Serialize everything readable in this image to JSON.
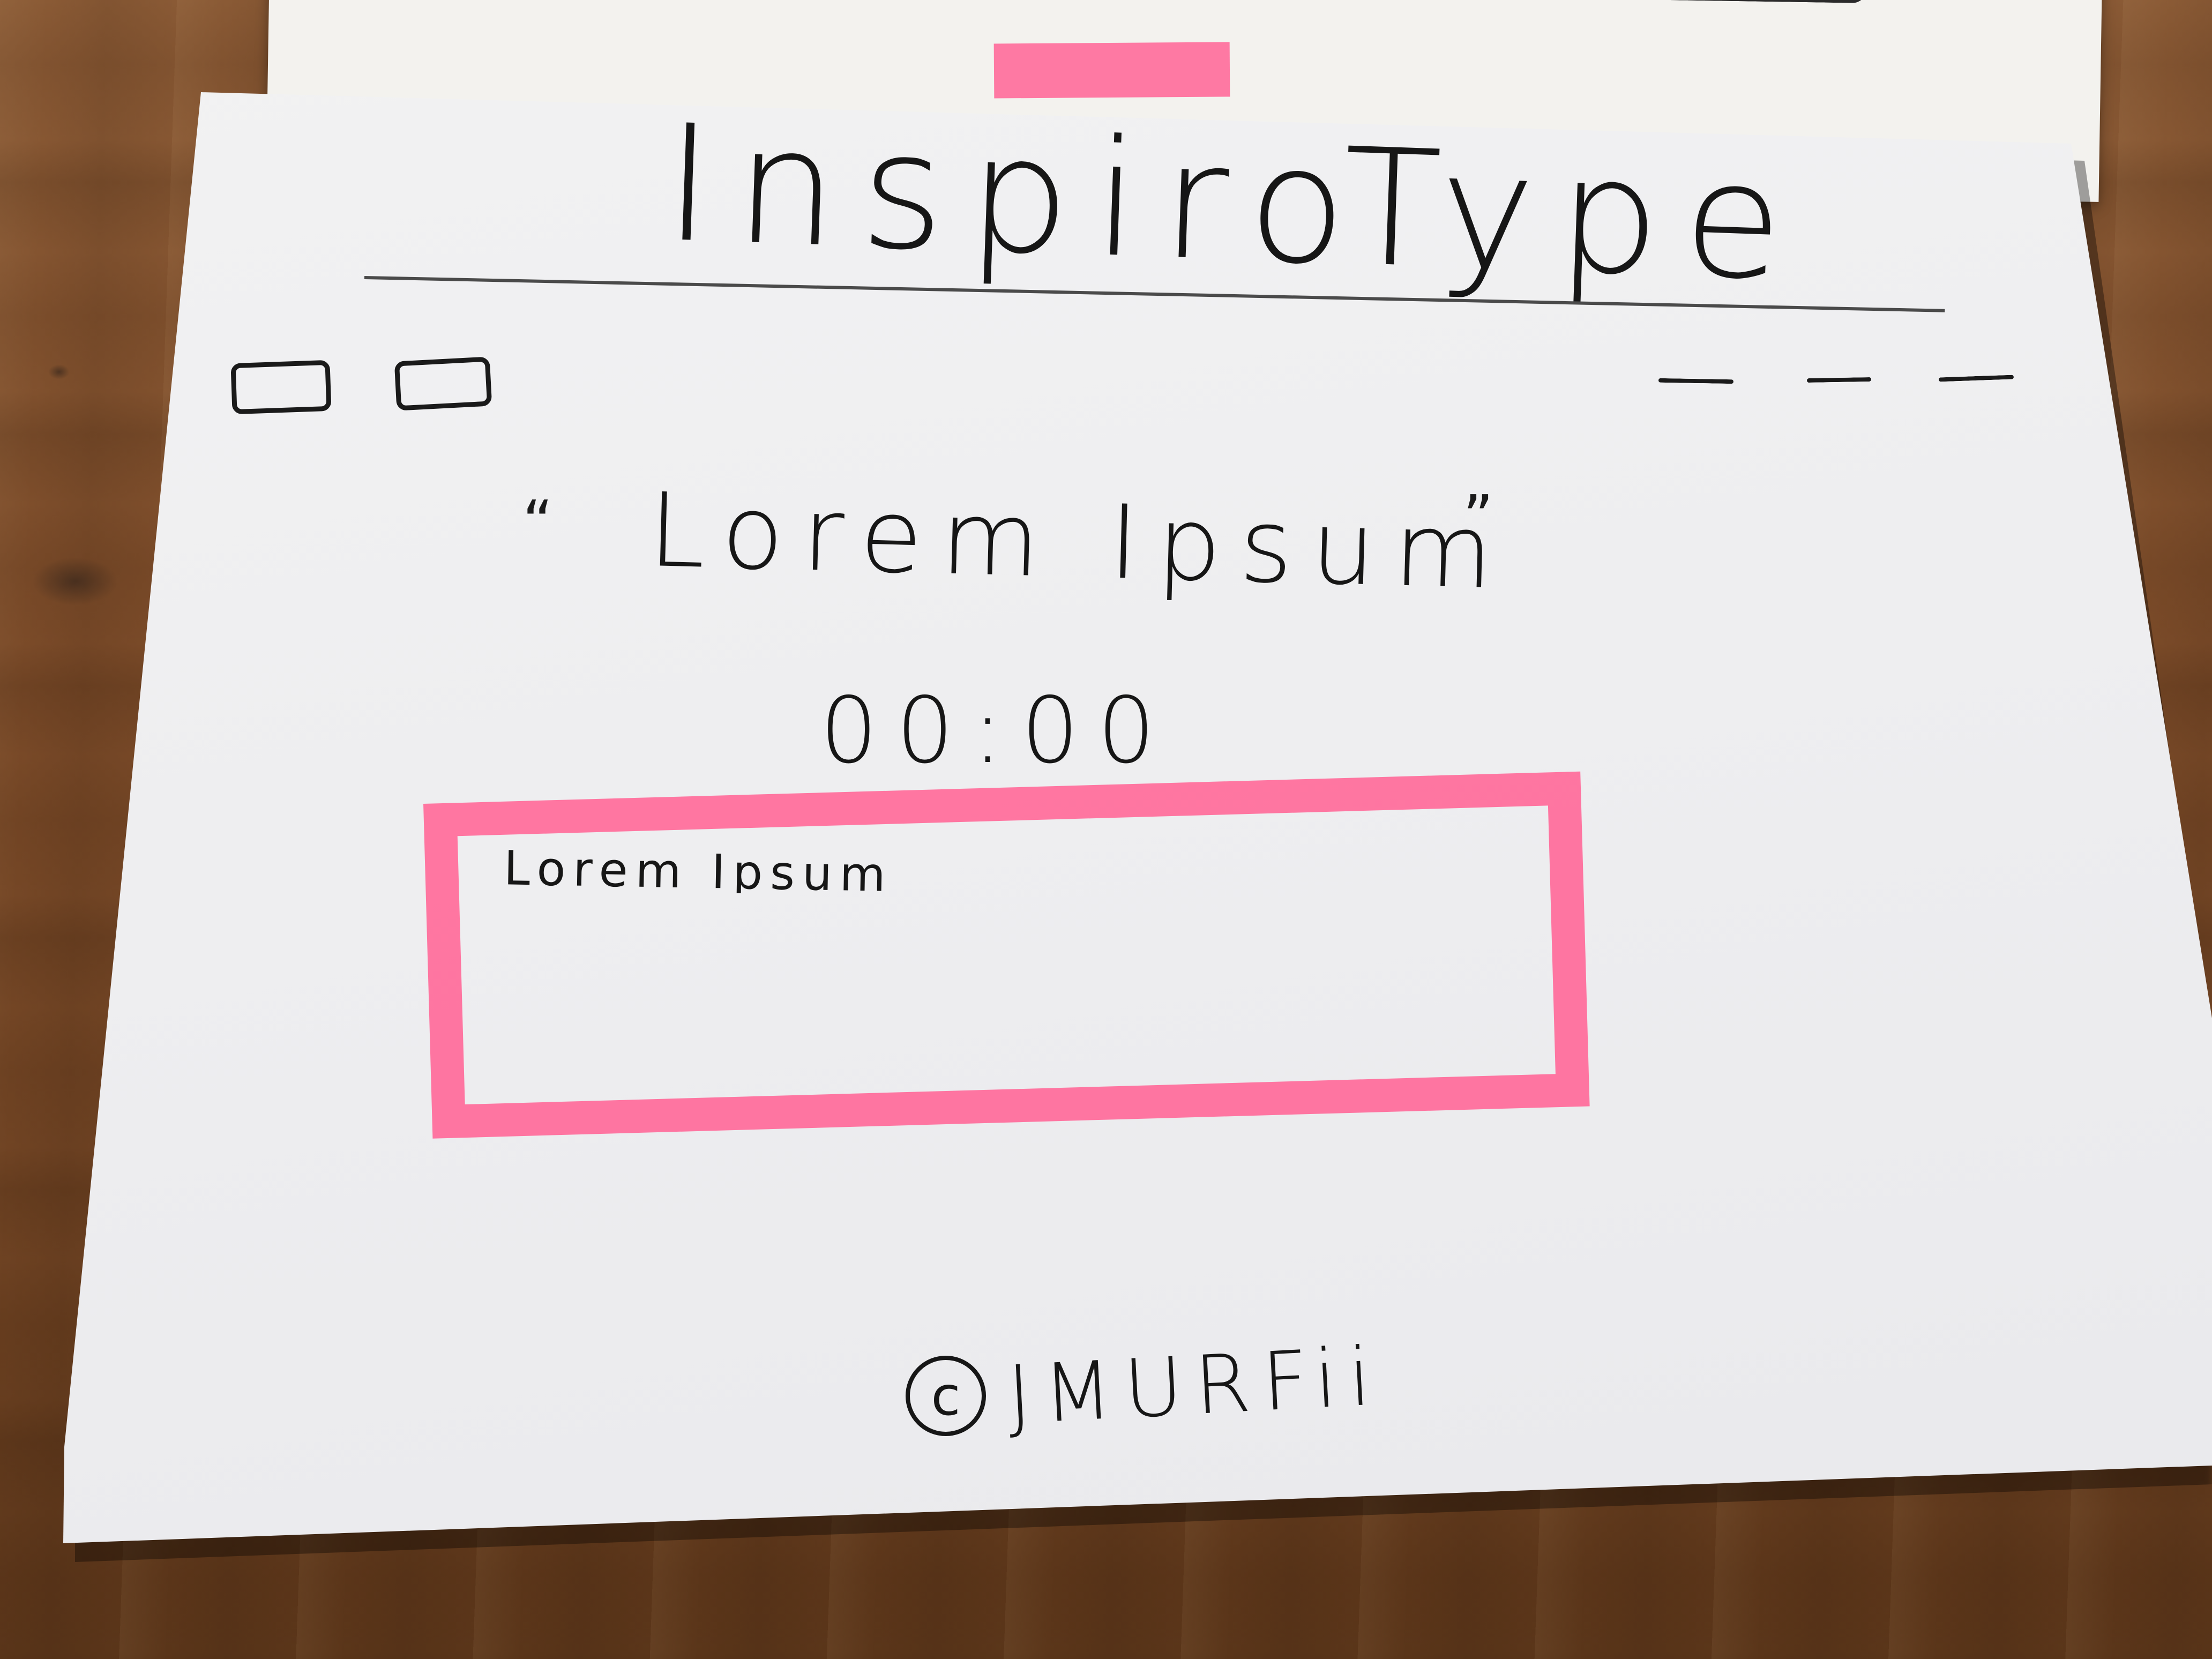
{
  "app": {
    "title": "InspiroType"
  },
  "window_controls": {
    "buttons": [
      "",
      ""
    ],
    "menu_items": [
      "",
      "",
      ""
    ]
  },
  "quote": {
    "open_mark": "“",
    "text": "Lorem Ipsum",
    "close_mark": "”"
  },
  "timer": {
    "value": "00:00"
  },
  "typing_area": {
    "value": "Lorem Ipsum",
    "accent_color": "#ff6f9c"
  },
  "footer": {
    "copyright_symbol": "c",
    "author": "JMURFii"
  },
  "colors": {
    "highlighter": "#ff6f9c",
    "ink": "#161616",
    "paper": "#efeff1"
  }
}
